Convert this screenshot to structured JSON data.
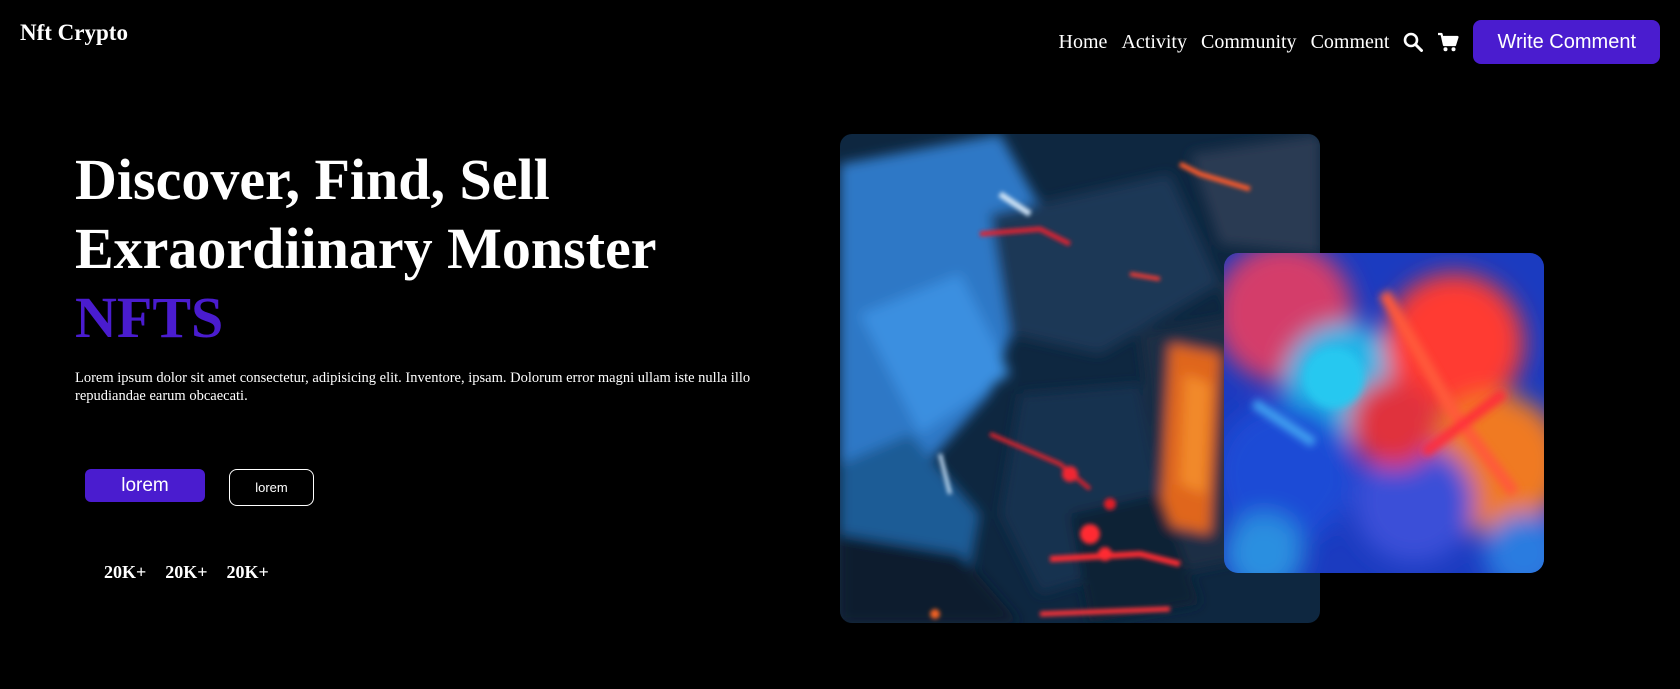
{
  "header": {
    "brand": "Nft Crypto",
    "nav": [
      {
        "label": "Home"
      },
      {
        "label": "Activity"
      },
      {
        "label": "Community"
      },
      {
        "label": "Comment"
      }
    ],
    "search_icon": "search-icon",
    "cart_icon": "cart-icon",
    "cta_label": "Write Comment"
  },
  "hero": {
    "title_line1": "Discover, Find, Sell",
    "title_line2": "Exraordiinary Monster",
    "title_accent": "NFTS",
    "description": "Lorem ipsum dolor sit amet consectetur, adipisicing elit. Inventore, ipsam. Dolorum error magni ullam iste nulla illo repudiandae earum obcaecati.",
    "primary_button": "lorem",
    "secondary_button": "lorem",
    "stats": [
      {
        "value": "20K+"
      },
      {
        "value": "20K+"
      },
      {
        "value": "20K+"
      }
    ]
  },
  "colors": {
    "accent": "#4a1ccf",
    "background": "#000000",
    "text": "#ffffff"
  },
  "images": [
    {
      "name": "abstract-painting-large",
      "kind": "image"
    },
    {
      "name": "abstract-painting-small",
      "kind": "image"
    }
  ]
}
